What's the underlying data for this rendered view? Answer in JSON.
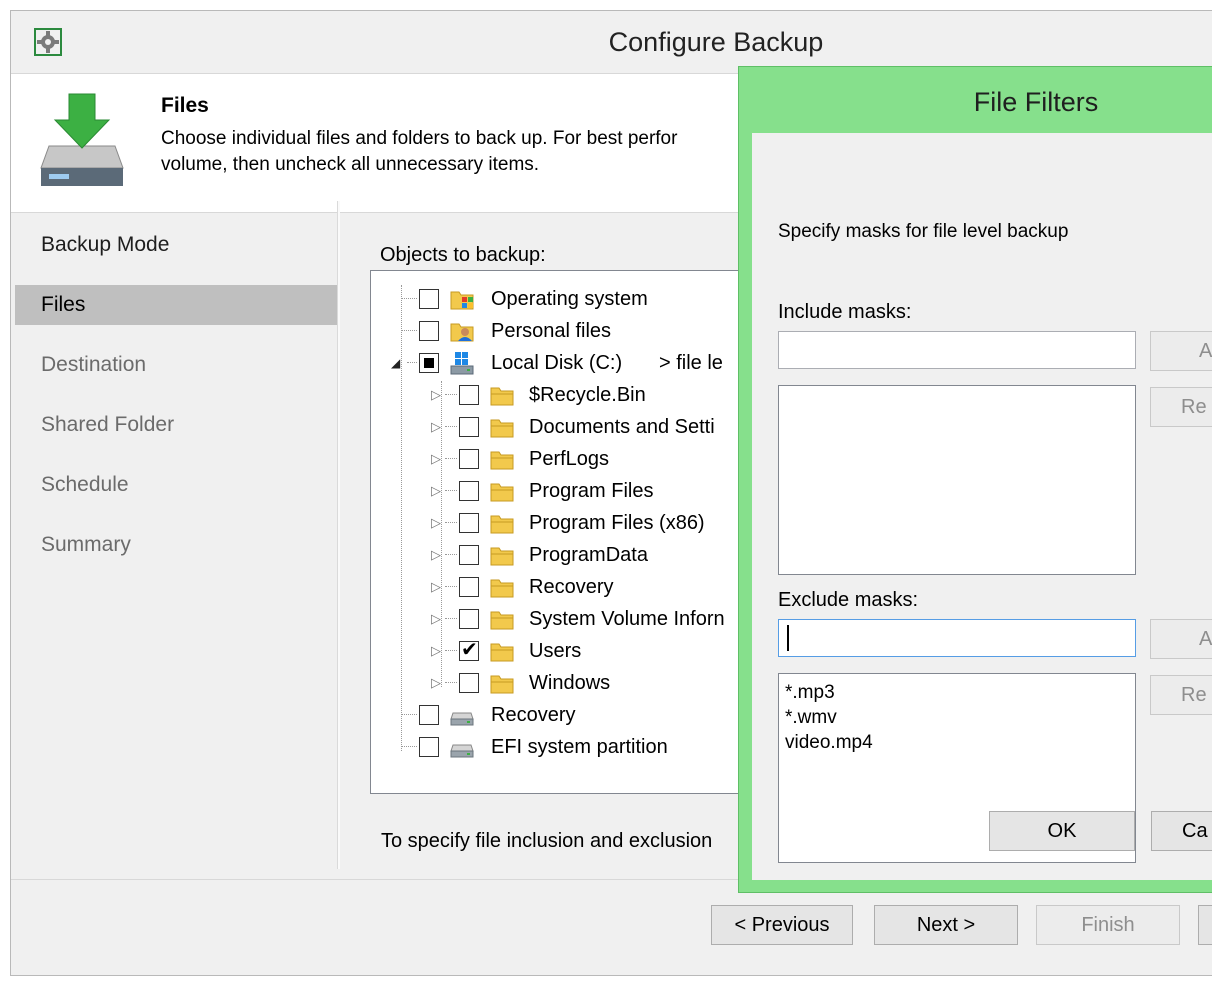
{
  "window": {
    "title": "Configure Backup"
  },
  "header": {
    "title": "Files",
    "description": "Choose individual files and folders to back up. For best perfor volume, then uncheck all unnecessary items."
  },
  "sidebar": {
    "items": [
      {
        "label": "Backup Mode"
      },
      {
        "label": "Files"
      },
      {
        "label": "Destination"
      },
      {
        "label": "Shared Folder"
      },
      {
        "label": "Schedule"
      },
      {
        "label": "Summary"
      }
    ]
  },
  "content": {
    "objects_label": "Objects to backup:",
    "hint": "To specify file inclusion and exclusion",
    "tree": [
      {
        "label": "Operating system"
      },
      {
        "label": "Personal files"
      },
      {
        "label": "Local Disk (C:)",
        "suffix": "> file le"
      },
      {
        "label": "$Recycle.Bin"
      },
      {
        "label": "Documents and Setti"
      },
      {
        "label": "PerfLogs"
      },
      {
        "label": "Program Files"
      },
      {
        "label": "Program Files (x86)"
      },
      {
        "label": "ProgramData"
      },
      {
        "label": "Recovery"
      },
      {
        "label": "System Volume Inforn"
      },
      {
        "label": "Users"
      },
      {
        "label": "Windows"
      },
      {
        "label": "Recovery"
      },
      {
        "label": "EFI system partition"
      }
    ]
  },
  "buttons": {
    "previous": "< Previous",
    "next": "Next >",
    "finish": "Finish"
  },
  "dialog": {
    "title": "File Filters",
    "subtitle": "Specify masks for file level backup",
    "include_label": "Include masks:",
    "exclude_label": "Exclude masks:",
    "include_input": "",
    "exclude_input": "",
    "add_label": "A",
    "remove_label": "Re",
    "exclude_list": [
      "*.mp3",
      "*.wmv",
      "video.mp4"
    ],
    "ok": "OK",
    "cancel": "Ca"
  },
  "colors": {
    "dialog_frame": "#86e08c",
    "selected_nav": "#bfbfbf",
    "arrow_green": "#3cb043",
    "folder_yellow": "#f2c94c"
  }
}
